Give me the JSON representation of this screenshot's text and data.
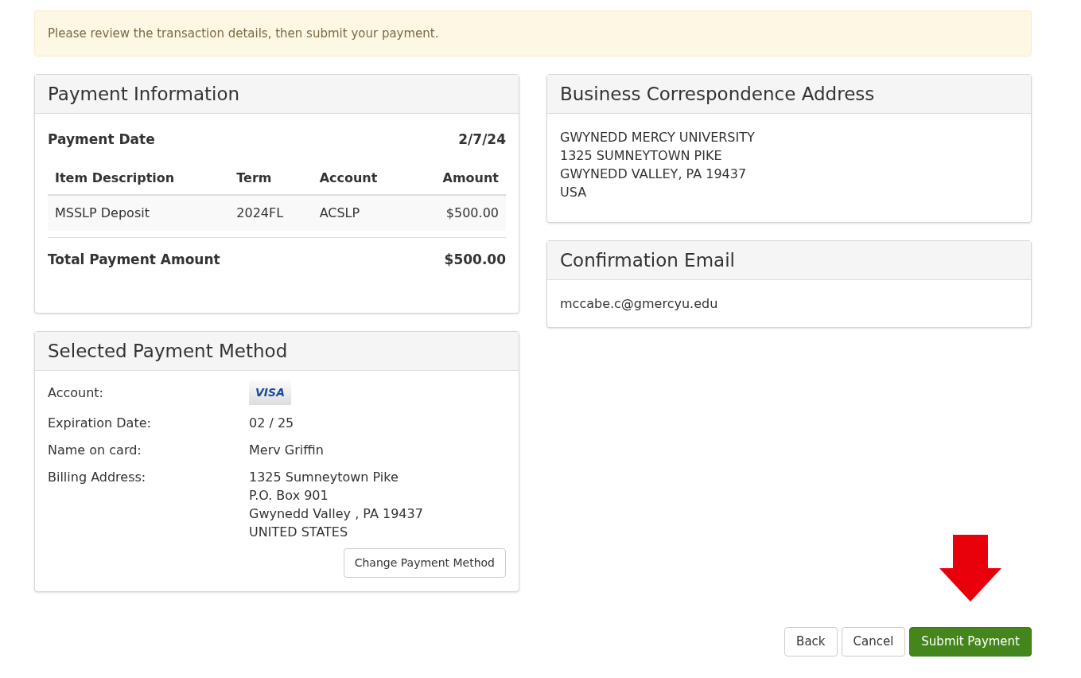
{
  "alert": {
    "text": "Please review the transaction details, then submit your payment."
  },
  "payment_information": {
    "title": "Payment Information",
    "date_label": "Payment Date",
    "date_value": "2/7/24",
    "columns": [
      "Item Description",
      "Term",
      "Account",
      "Amount"
    ],
    "rows": [
      [
        "MSSLP Deposit",
        "2024FL",
        "ACSLP",
        "$500.00"
      ]
    ],
    "total_label": "Total Payment Amount",
    "total_value": "$500.00"
  },
  "selected_payment_method": {
    "title": "Selected Payment Method",
    "fields": [
      {
        "label": "Account:",
        "kind": "card",
        "card_brand": "VISA"
      },
      {
        "label": "Expiration Date:",
        "kind": "text",
        "lines": [
          "02 / 25"
        ]
      },
      {
        "label": "Name on card:",
        "kind": "text",
        "lines": [
          "Merv Griffin"
        ]
      },
      {
        "label": "Billing Address:",
        "kind": "text",
        "lines": [
          "1325 Sumneytown Pike",
          "P.O. Box 901",
          "Gwynedd Valley , PA 19437",
          "UNITED STATES"
        ]
      }
    ],
    "change_button": "Change Payment Method"
  },
  "business_correspondence_address": {
    "title": "Business Correspondence Address",
    "lines": [
      "GWYNEDD MERCY UNIVERSITY",
      "1325 SUMNEYTOWN PIKE",
      "GWYNEDD VALLEY, PA 19437",
      "USA"
    ]
  },
  "confirmation_email": {
    "title": "Confirmation Email",
    "email": "mccabe.c@gmercyu.edu"
  },
  "buttons": [
    {
      "label": "Back",
      "kind": "default"
    },
    {
      "label": "Cancel",
      "kind": "default"
    },
    {
      "label": "Submit Payment",
      "kind": "primary"
    }
  ]
}
